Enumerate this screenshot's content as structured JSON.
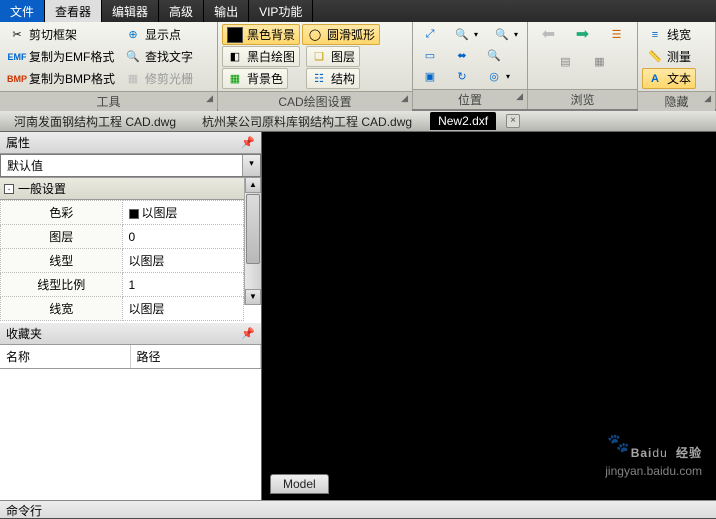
{
  "menu": {
    "file": "文件",
    "viewer": "查看器",
    "editor": "编辑器",
    "advanced": "高级",
    "output": "输出",
    "vip": "VIP功能"
  },
  "tools_group": {
    "title": "工具",
    "clip_frame": "剪切框架",
    "copy_emf": "复制为EMF格式",
    "copy_bmp": "复制为BMP格式",
    "show_points": "显示点",
    "find_text": "查找文字",
    "clear_aperture": "修剪光栅"
  },
  "cad_group": {
    "title": "CAD绘图设置",
    "black_bg": "黑色背景",
    "smooth_arc": "圆滑弧形",
    "bw_draw": "黑白绘图",
    "layer": "图层",
    "bg_color": "背景色",
    "structure": "结构"
  },
  "position_group": {
    "title": "位置"
  },
  "browse_group": {
    "title": "浏览"
  },
  "hide_group": {
    "title": "隐藏",
    "linewidth": "线宽",
    "measure": "测量",
    "text": "文本"
  },
  "tabs": {
    "t1": "河南发面钢结构工程 CAD.dwg",
    "t2": "杭州某公司原料库钢结构工程 CAD.dwg",
    "t3": "New2.dxf"
  },
  "properties": {
    "title": "属性",
    "default": "默认值",
    "section": "一般设置",
    "rows": {
      "color_label": "色彩",
      "color_value": "以图层",
      "layer_label": "图层",
      "layer_value": "0",
      "ltype_label": "线型",
      "ltype_value": "以图层",
      "lscale_label": "线型比例",
      "lscale_value": "1",
      "lwidth_label": "线宽",
      "lwidth_value": "以图层"
    }
  },
  "favorites": {
    "title": "收藏夹",
    "col_name": "名称",
    "col_path": "路径"
  },
  "viewport": {
    "model": "Model"
  },
  "watermark": {
    "brand": "Baidu 经验",
    "url": "jingyan.baidu.com"
  },
  "cmdline": "命令行"
}
